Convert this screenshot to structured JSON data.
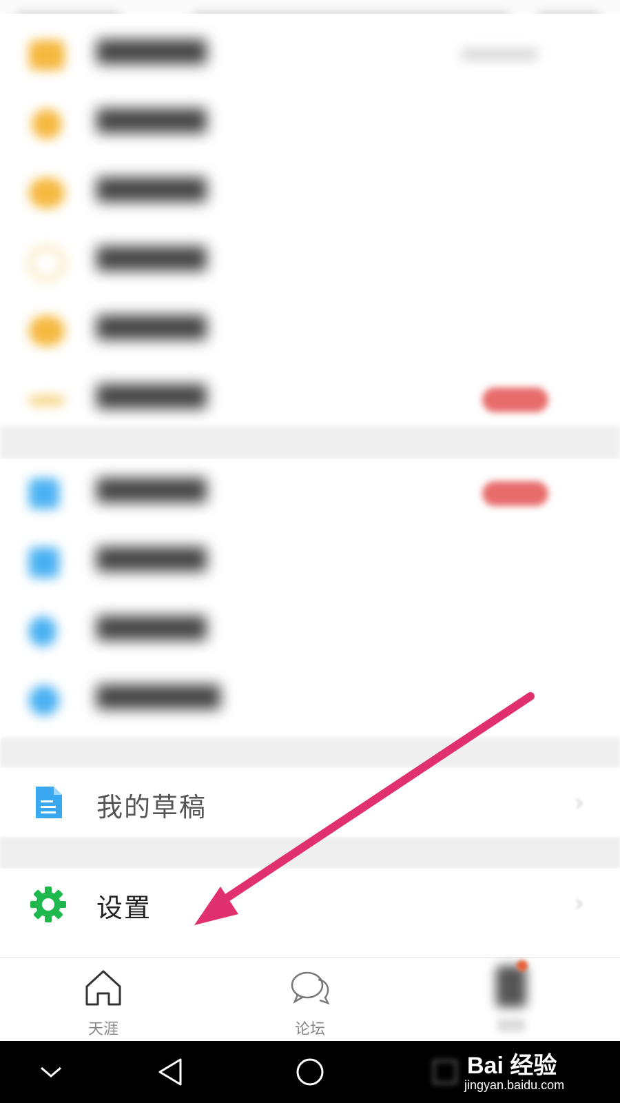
{
  "colors": {
    "gear": "#1fb84f",
    "draft_icon": "#3aa8f0",
    "arrow": "#e0306e",
    "yellow": "#f5b83d",
    "blue": "#4ab1f2"
  },
  "menu": {
    "draft": {
      "label": "我的草稿",
      "icon": "document-icon"
    },
    "settings": {
      "label": "设置",
      "icon": "gear-icon"
    }
  },
  "tabs": [
    {
      "label": "天涯",
      "icon": "home-icon"
    },
    {
      "label": "论坛",
      "icon": "chat-bubbles-icon"
    },
    {
      "label": "",
      "icon": "profile-avatar"
    }
  ],
  "system_nav": [
    "back-chevron-down-icon",
    "back-triangle-icon",
    "home-circle-icon",
    "recents-square-icon"
  ],
  "watermark": {
    "brand": "Bai 经验",
    "url": "jingyan.baidu.com"
  }
}
